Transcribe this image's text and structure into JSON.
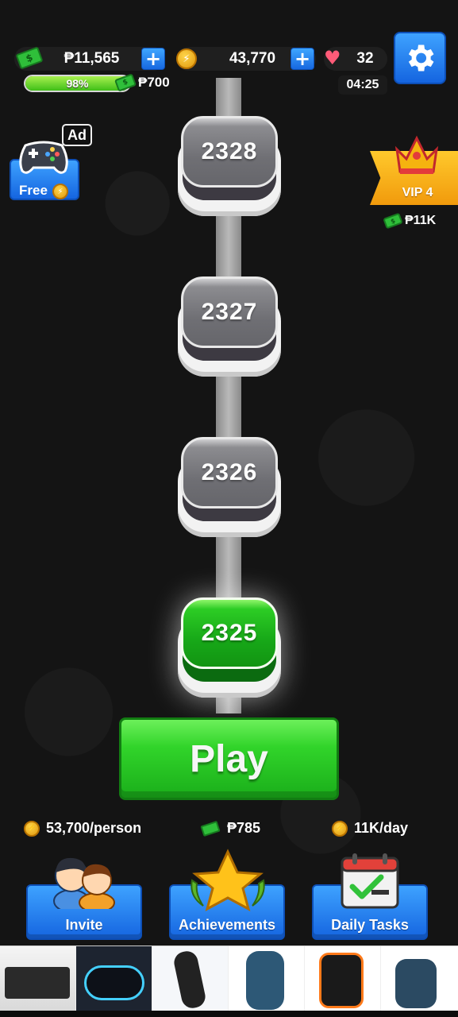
{
  "top_bar": {
    "cash_value": "₱11,565",
    "coins_value": "43,770",
    "lives_value": "32",
    "timer": "04:25",
    "level_progress_percent": 98,
    "level_progress_label": "98%",
    "level_reward": "₱700",
    "plus_symbol": "+"
  },
  "side_left": {
    "ad_badge": "Ad",
    "free_label": "Free"
  },
  "side_right": {
    "vip_label": "VIP 4",
    "vip_reward": "₱11K"
  },
  "levels": [
    "2328",
    "2327",
    "2326",
    "2325"
  ],
  "current_level": "2325",
  "play_button": "Play",
  "rewards": {
    "invite": "53,700/person",
    "achievements": "₱785",
    "daily_tasks": "11K/day"
  },
  "features": {
    "invite": "Invite",
    "achievements": "Achievements",
    "daily_tasks": "Daily Tasks"
  },
  "colors": {
    "accent_blue": "#1e7cf0",
    "play_green": "#22c21f",
    "gold": "#f5b30f"
  },
  "icons": {
    "cash": "banknote-icon",
    "coin": "coin-icon",
    "heart": "heart-icon",
    "settings": "gear-icon",
    "gamepad": "gamepad-icon",
    "crown": "crown-icon",
    "invite": "two-people-icon",
    "achievements": "star-icon",
    "daily_tasks": "calendar-check-icon"
  }
}
